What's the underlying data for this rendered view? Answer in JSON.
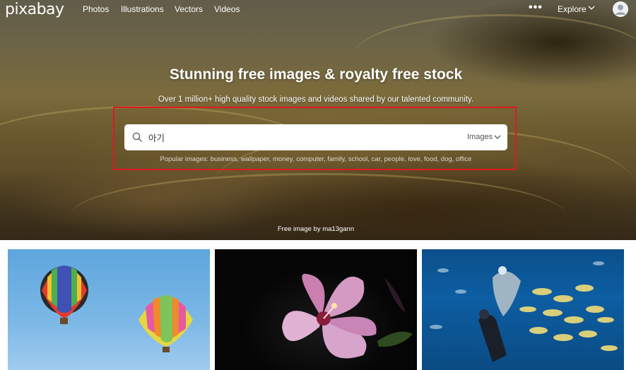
{
  "nav": {
    "logo": "pixabay",
    "links": [
      "Photos",
      "Illustrations",
      "Vectors",
      "Videos"
    ],
    "more": "•••",
    "explore": "Explore"
  },
  "hero": {
    "title": "Stunning free images & royalty free stock",
    "subtitle": "Over 1 million+ high quality stock images and videos shared by our talented community.",
    "credit": "Free image by ma13gann"
  },
  "search": {
    "value": "아기",
    "type": "Images",
    "popular": "Popular images: business, wallpaper, money, computer, family, school, car, people, love, food, dog, office"
  },
  "colors": {
    "highlight": "#e0191f"
  },
  "gallery": [
    {
      "subject": "hot-air-balloons"
    },
    {
      "subject": "pink-hibiscus-flower"
    },
    {
      "subject": "scuba-diver-aquarium"
    }
  ]
}
